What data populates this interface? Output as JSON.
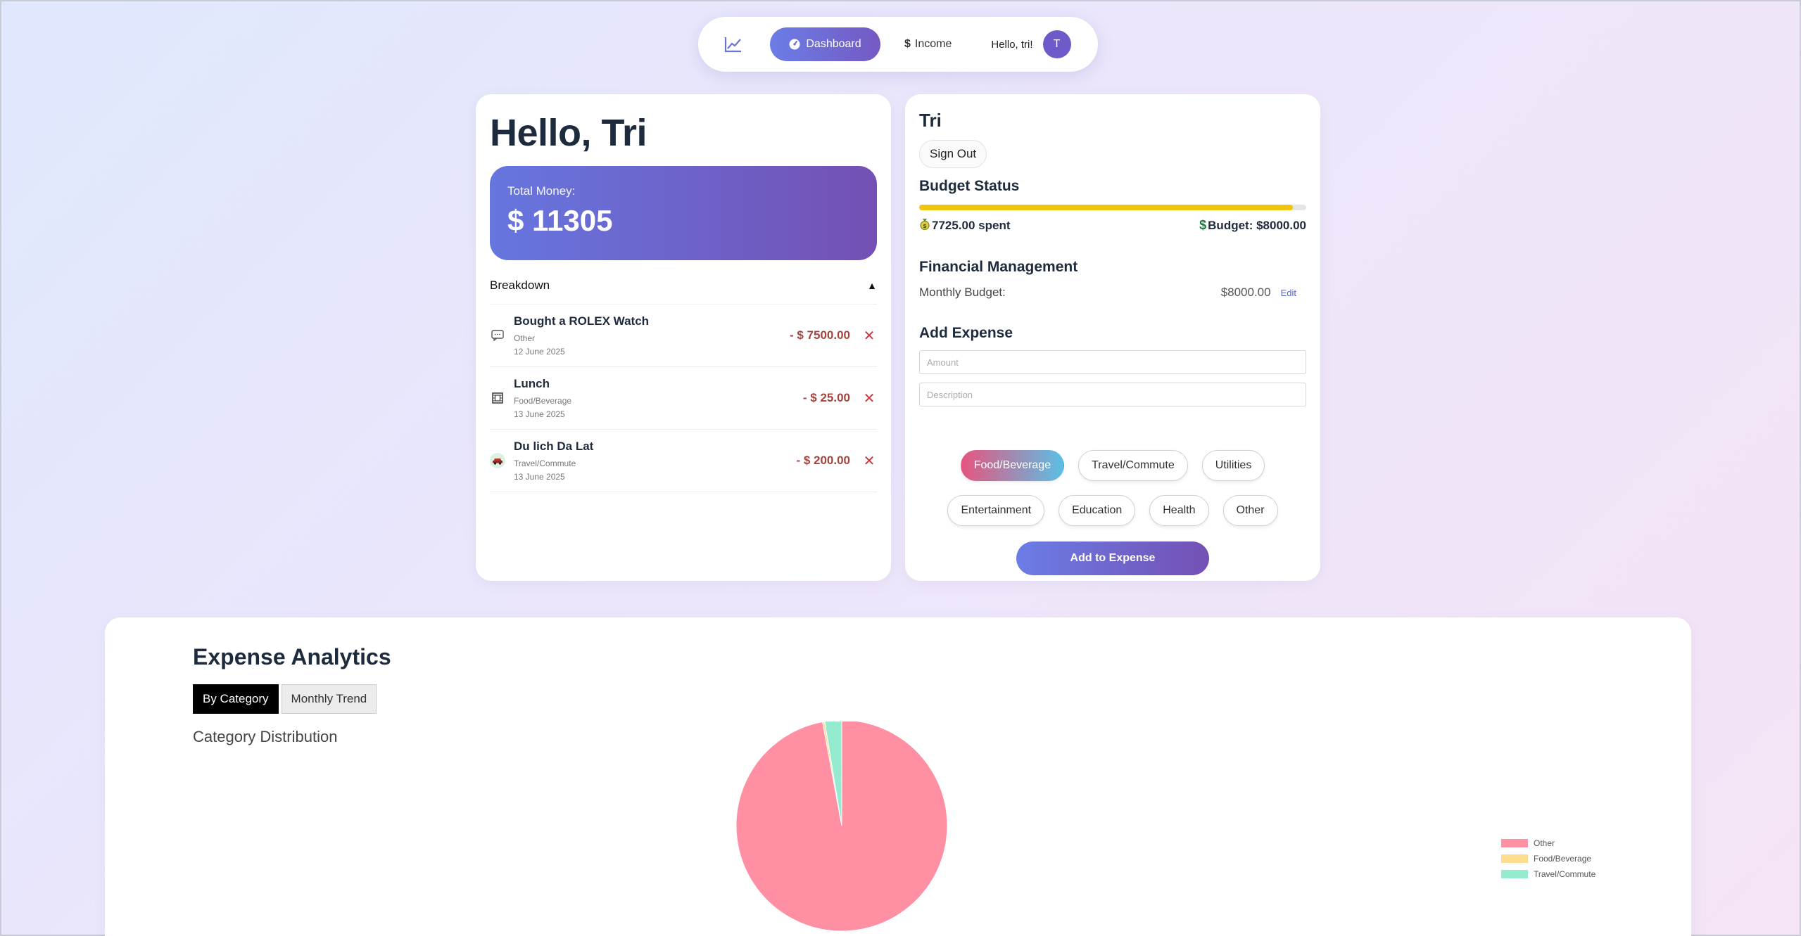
{
  "nav": {
    "dashboard_label": "Dashboard",
    "income_label": "Income",
    "hello": "Hello, tri!",
    "avatar_initial": "T"
  },
  "left": {
    "greeting": "Hello, Tri",
    "total_label": "Total Money:",
    "total_value": "$ 11305",
    "breakdown_label": "Breakdown",
    "breakdown_toggle": "▲",
    "expenses": [
      {
        "title": "Bought a ROLEX Watch",
        "category": "Other",
        "date": "12 June 2025",
        "amount": "- $ 7500.00",
        "icon": "speech-bubble-icon"
      },
      {
        "title": "Lunch",
        "category": "Food/Beverage",
        "date": "13 June 2025",
        "amount": "- $ 25.00",
        "icon": "film-frame-icon"
      },
      {
        "title": "Du lich Da Lat",
        "category": "Travel/Commute",
        "date": "13 June 2025",
        "amount": "- $ 200.00",
        "icon": "car-icon"
      }
    ]
  },
  "right": {
    "user_name": "Tri",
    "signout_label": "Sign Out",
    "budget_title": "Budget Status",
    "budget_progress": 0.966,
    "spent_text": "7725.00 spent",
    "budget_text": "Budget: $8000.00",
    "fm_title": "Financial Management",
    "monthly_budget_label": "Monthly Budget:",
    "monthly_budget_value": "$8000.00",
    "edit_label": "Edit",
    "add_title": "Add Expense",
    "amount_placeholder": "Amount",
    "description_placeholder": "Description",
    "categories": [
      "Food/Beverage",
      "Travel/Commute",
      "Utilities",
      "Entertainment",
      "Education",
      "Health",
      "Other"
    ],
    "active_category": "Food/Beverage",
    "add_button_label": "Add to Expense"
  },
  "analytics": {
    "title": "Expense Analytics",
    "tabs": [
      "By Category",
      "Monthly Trend"
    ],
    "active_tab": "By Category",
    "subtitle": "Category Distribution"
  },
  "chart_data": {
    "type": "pie",
    "title": "",
    "categories": [
      "Other",
      "Food/Beverage",
      "Travel/Commute"
    ],
    "values": [
      7500,
      25,
      200
    ],
    "colors": [
      "#ff8fa3",
      "#ffdd8f",
      "#94ebcf"
    ],
    "legend_position": "right"
  },
  "colors": {
    "accent": "#6b7de6",
    "accent_dark": "#7450b4",
    "danger": "#a3443f",
    "progress": "#f1c40f"
  }
}
